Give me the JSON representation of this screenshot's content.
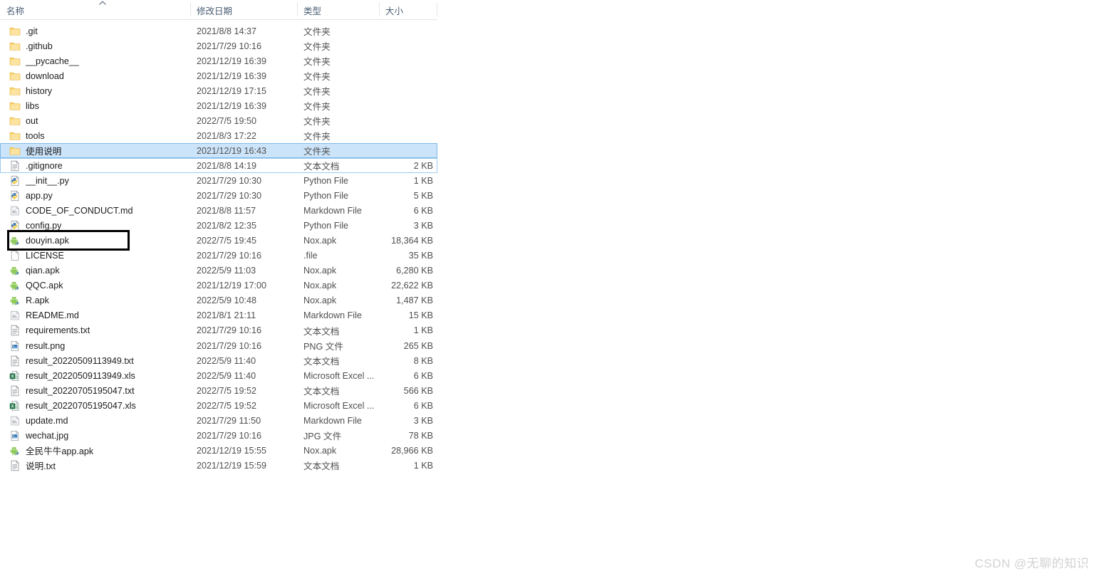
{
  "header": {
    "columns": [
      {
        "id": "name",
        "label": "名称",
        "sorted": true,
        "sort_direction": "ascending"
      },
      {
        "id": "date",
        "label": "修改日期"
      },
      {
        "id": "type",
        "label": "类型"
      },
      {
        "id": "size",
        "label": "大小"
      }
    ]
  },
  "colors": {
    "selection_fill": "#cce4fa",
    "selection_border": "#7eb9e8",
    "folder_icon": "#f8d775",
    "annotation_border": "#000000",
    "watermark": "#d2d2d2",
    "header_text": "#4a5d73"
  },
  "annotation": {
    "target_file": "douyin.apk",
    "shape": "rectangle",
    "color": "#000000"
  },
  "watermark": {
    "text": "CSDN @无聊的知识"
  },
  "files": [
    {
      "name": ".git",
      "date": "2021/8/8 14:37",
      "type": "文件夹",
      "size": "",
      "icon": "folder-icon",
      "state": "normal"
    },
    {
      "name": ".github",
      "date": "2021/7/29 10:16",
      "type": "文件夹",
      "size": "",
      "icon": "folder-icon",
      "state": "normal"
    },
    {
      "name": "__pycache__",
      "date": "2021/12/19 16:39",
      "type": "文件夹",
      "size": "",
      "icon": "folder-icon",
      "state": "normal"
    },
    {
      "name": "download",
      "date": "2021/12/19 16:39",
      "type": "文件夹",
      "size": "",
      "icon": "folder-icon",
      "state": "normal"
    },
    {
      "name": "history",
      "date": "2021/12/19 17:15",
      "type": "文件夹",
      "size": "",
      "icon": "folder-icon",
      "state": "normal"
    },
    {
      "name": "libs",
      "date": "2021/12/19 16:39",
      "type": "文件夹",
      "size": "",
      "icon": "folder-icon",
      "state": "normal"
    },
    {
      "name": "out",
      "date": "2022/7/5 19:50",
      "type": "文件夹",
      "size": "",
      "icon": "folder-icon",
      "state": "normal"
    },
    {
      "name": "tools",
      "date": "2021/8/3 17:22",
      "type": "文件夹",
      "size": "",
      "icon": "folder-icon",
      "state": "normal"
    },
    {
      "name": "使用说明",
      "date": "2021/12/19 16:43",
      "type": "文件夹",
      "size": "",
      "icon": "folder-icon",
      "state": "selected"
    },
    {
      "name": ".gitignore",
      "date": "2021/8/8 14:19",
      "type": "文本文档",
      "size": "2 KB",
      "icon": "text-file-icon",
      "state": "focused"
    },
    {
      "name": "__init__.py",
      "date": "2021/7/29 10:30",
      "type": "Python File",
      "size": "1 KB",
      "icon": "python-icon",
      "state": "normal"
    },
    {
      "name": "app.py",
      "date": "2021/7/29 10:30",
      "type": "Python File",
      "size": "5 KB",
      "icon": "python-icon",
      "state": "normal"
    },
    {
      "name": "CODE_OF_CONDUCT.md",
      "date": "2021/8/8 11:57",
      "type": "Markdown File",
      "size": "6 KB",
      "icon": "markdown-icon",
      "state": "normal"
    },
    {
      "name": "config.py",
      "date": "2021/8/2 12:35",
      "type": "Python File",
      "size": "3 KB",
      "icon": "python-icon",
      "state": "normal"
    },
    {
      "name": "douyin.apk",
      "date": "2022/7/5 19:45",
      "type": "Nox.apk",
      "size": "18,364 KB",
      "icon": "apk-icon",
      "state": "annotated"
    },
    {
      "name": "LICENSE",
      "date": "2021/7/29 10:16",
      "type": ".file",
      "size": "35 KB",
      "icon": "blank-file-icon",
      "state": "normal"
    },
    {
      "name": "qian.apk",
      "date": "2022/5/9 11:03",
      "type": "Nox.apk",
      "size": "6,280 KB",
      "icon": "apk-icon",
      "state": "normal"
    },
    {
      "name": "QQC.apk",
      "date": "2021/12/19 17:00",
      "type": "Nox.apk",
      "size": "22,622 KB",
      "icon": "apk-icon",
      "state": "normal"
    },
    {
      "name": "R.apk",
      "date": "2022/5/9 10:48",
      "type": "Nox.apk",
      "size": "1,487 KB",
      "icon": "apk-icon",
      "state": "normal"
    },
    {
      "name": "README.md",
      "date": "2021/8/1 21:11",
      "type": "Markdown File",
      "size": "15 KB",
      "icon": "markdown-icon",
      "state": "normal"
    },
    {
      "name": "requirements.txt",
      "date": "2021/7/29 10:16",
      "type": "文本文档",
      "size": "1 KB",
      "icon": "text-file-icon",
      "state": "normal"
    },
    {
      "name": "result.png",
      "date": "2021/7/29 10:16",
      "type": "PNG 文件",
      "size": "265 KB",
      "icon": "image-icon",
      "state": "normal"
    },
    {
      "name": "result_20220509113949.txt",
      "date": "2022/5/9 11:40",
      "type": "文本文档",
      "size": "8 KB",
      "icon": "text-file-icon",
      "state": "normal"
    },
    {
      "name": "result_20220509113949.xls",
      "date": "2022/5/9 11:40",
      "type": "Microsoft Excel ...",
      "size": "6 KB",
      "icon": "excel-icon",
      "state": "normal"
    },
    {
      "name": "result_20220705195047.txt",
      "date": "2022/7/5 19:52",
      "type": "文本文档",
      "size": "566 KB",
      "icon": "text-file-icon",
      "state": "normal"
    },
    {
      "name": "result_20220705195047.xls",
      "date": "2022/7/5 19:52",
      "type": "Microsoft Excel ...",
      "size": "6 KB",
      "icon": "excel-icon",
      "state": "normal"
    },
    {
      "name": "update.md",
      "date": "2021/7/29 11:50",
      "type": "Markdown File",
      "size": "3 KB",
      "icon": "markdown-icon",
      "state": "normal"
    },
    {
      "name": "wechat.jpg",
      "date": "2021/7/29 10:16",
      "type": "JPG 文件",
      "size": "78 KB",
      "icon": "image-icon",
      "state": "normal"
    },
    {
      "name": "全民牛牛app.apk",
      "date": "2021/12/19 15:55",
      "type": "Nox.apk",
      "size": "28,966 KB",
      "icon": "apk-icon",
      "state": "normal"
    },
    {
      "name": "说明.txt",
      "date": "2021/12/19 15:59",
      "type": "文本文档",
      "size": "1 KB",
      "icon": "text-file-icon",
      "state": "normal"
    }
  ]
}
